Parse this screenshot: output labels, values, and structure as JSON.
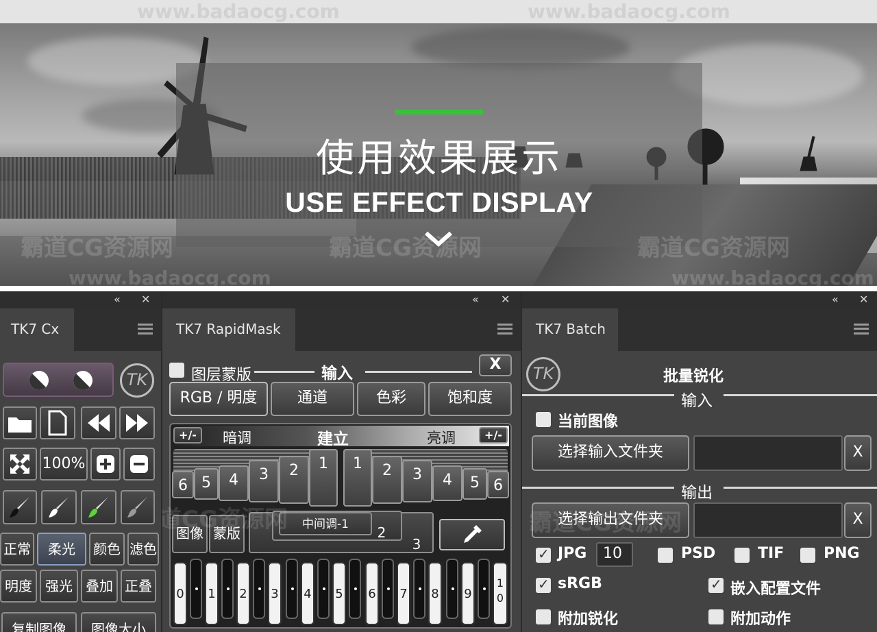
{
  "hero": {
    "title_cn": "使用效果展示",
    "title_en": "USE EFFECT DISPLAY",
    "accent_color": "#38c23a",
    "watermarks": [
      "www.badaocg.com",
      "www.badaocg.com",
      "霸道CG资源网",
      "霸道CG资源网",
      "霸道CG资源网",
      "www.badaocg.com",
      "www.badaocg.com"
    ]
  },
  "panel_controls": {
    "collapse": "«",
    "close": "✕"
  },
  "cx": {
    "tab": "TK7 Cx",
    "logo": "TK",
    "zoom_label": "100%",
    "blend_row1": [
      "正常",
      "柔光",
      "颜色",
      "滤色"
    ],
    "blend_row2": [
      "明度",
      "强光",
      "叠加",
      "正叠"
    ],
    "bottom": [
      "复制图像",
      "图像大小"
    ]
  },
  "rapidmask": {
    "tab": "TK7 RapidMask",
    "layer_mask_label": "图层蒙版",
    "input_label": "输入",
    "close": "X",
    "modes": [
      "RGB / 明度",
      "通道",
      "色彩",
      "饱和度"
    ],
    "plus_minus": "+/-",
    "shadows": "暗调",
    "build": "建立",
    "highlights": "亮调",
    "left_keys": [
      "6",
      "5",
      "4",
      "3",
      "2",
      "1"
    ],
    "right_keys": [
      "1",
      "2",
      "3",
      "4",
      "5",
      "6"
    ],
    "image_btn": "图像",
    "mask_btn": "蒙版",
    "midtone": "中间调-1",
    "mid2": "2",
    "mid3": "3",
    "zone_keys": [
      "0",
      "1",
      "2",
      "3",
      "4",
      "5",
      "6",
      "7",
      "8",
      "9",
      "10"
    ],
    "watermark": "霸道CG资源网"
  },
  "batch": {
    "tab": "TK7 Batch",
    "logo": "TK",
    "title": "批量锐化",
    "input_label": "输入",
    "current_image": "当前图像",
    "select_input": "选择输入文件夹",
    "output_label": "输出",
    "select_output": "选择输出文件夹",
    "x": "X",
    "jpg": "JPG",
    "jpg_quality": "10",
    "psd": "PSD",
    "tif": "TIF",
    "png": "PNG",
    "srgb": "sRGB",
    "embed_profile": "嵌入配置文件",
    "add_sharpen": "附加锐化",
    "add_action": "附加动作",
    "watermark": "霸道CG资源网"
  }
}
